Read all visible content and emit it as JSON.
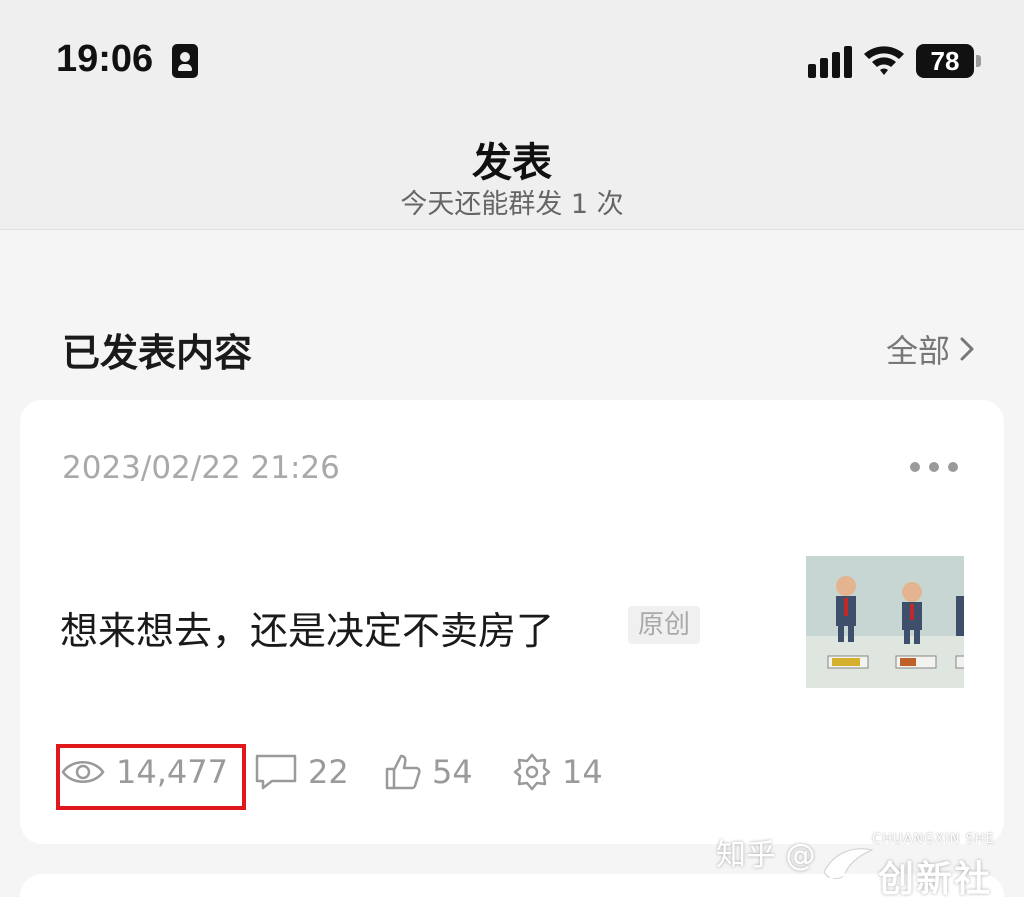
{
  "status_bar": {
    "time": "19:06",
    "battery": "78"
  },
  "header": {
    "title": "发表",
    "subtitle": "今天还能群发 1 次"
  },
  "section": {
    "title": "已发表内容",
    "all_label": "全部"
  },
  "post": {
    "date": "2023/02/22 21:26",
    "title": "想来想去，还是决定不卖房了",
    "badge": "原创",
    "stats": {
      "views": "14,477",
      "comments": "22",
      "likes": "54",
      "shares": "14"
    }
  },
  "watermark": {
    "text": "知乎 @",
    "brand": "创新社",
    "brand_pinyin": "CHUANGXIN SHE"
  },
  "colors": {
    "highlight": "#e0181b",
    "muted": "#9a9a9a",
    "background": "#f5f5f5",
    "card": "#ffffff"
  },
  "icons": [
    "id-card-icon",
    "signal-icon",
    "wifi-icon",
    "battery-icon",
    "chevron-right-icon",
    "more-icon",
    "eye-icon",
    "comment-icon",
    "thumbs-up-icon",
    "share-icon"
  ]
}
